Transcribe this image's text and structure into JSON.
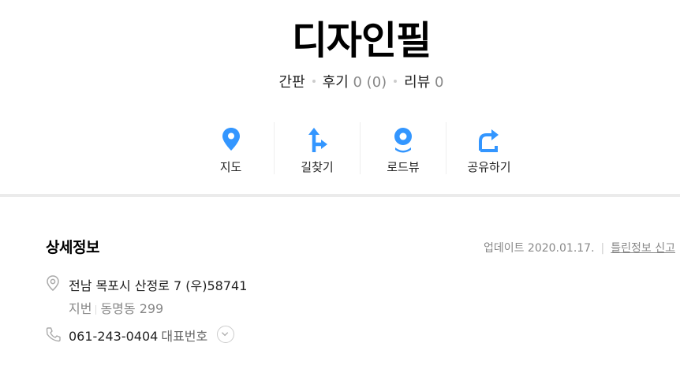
{
  "place": {
    "name": "디자인필",
    "category": "간판",
    "review_label": "후기",
    "review_count": "0 (0)",
    "blog_label": "리뷰",
    "blog_count": "0"
  },
  "actions": [
    {
      "label": "지도",
      "icon": "map-pin-icon"
    },
    {
      "label": "길찾기",
      "icon": "directions-icon"
    },
    {
      "label": "로드뷰",
      "icon": "roadview-icon"
    },
    {
      "label": "공유하기",
      "icon": "share-icon"
    }
  ],
  "detail": {
    "title": "상세정보",
    "update_text": "업데이트 2020.01.17.",
    "separator": "|",
    "report_label": "틀린정보 신고",
    "address": "전남 목포시 산정로 7 (우)58741",
    "jibun_label": "지번",
    "jibun_value": "동명동 299",
    "phone": "061-243-0404",
    "phone_type": "대표번호"
  },
  "colors": {
    "accent": "#3396ff",
    "divider": "#ebebeb"
  }
}
